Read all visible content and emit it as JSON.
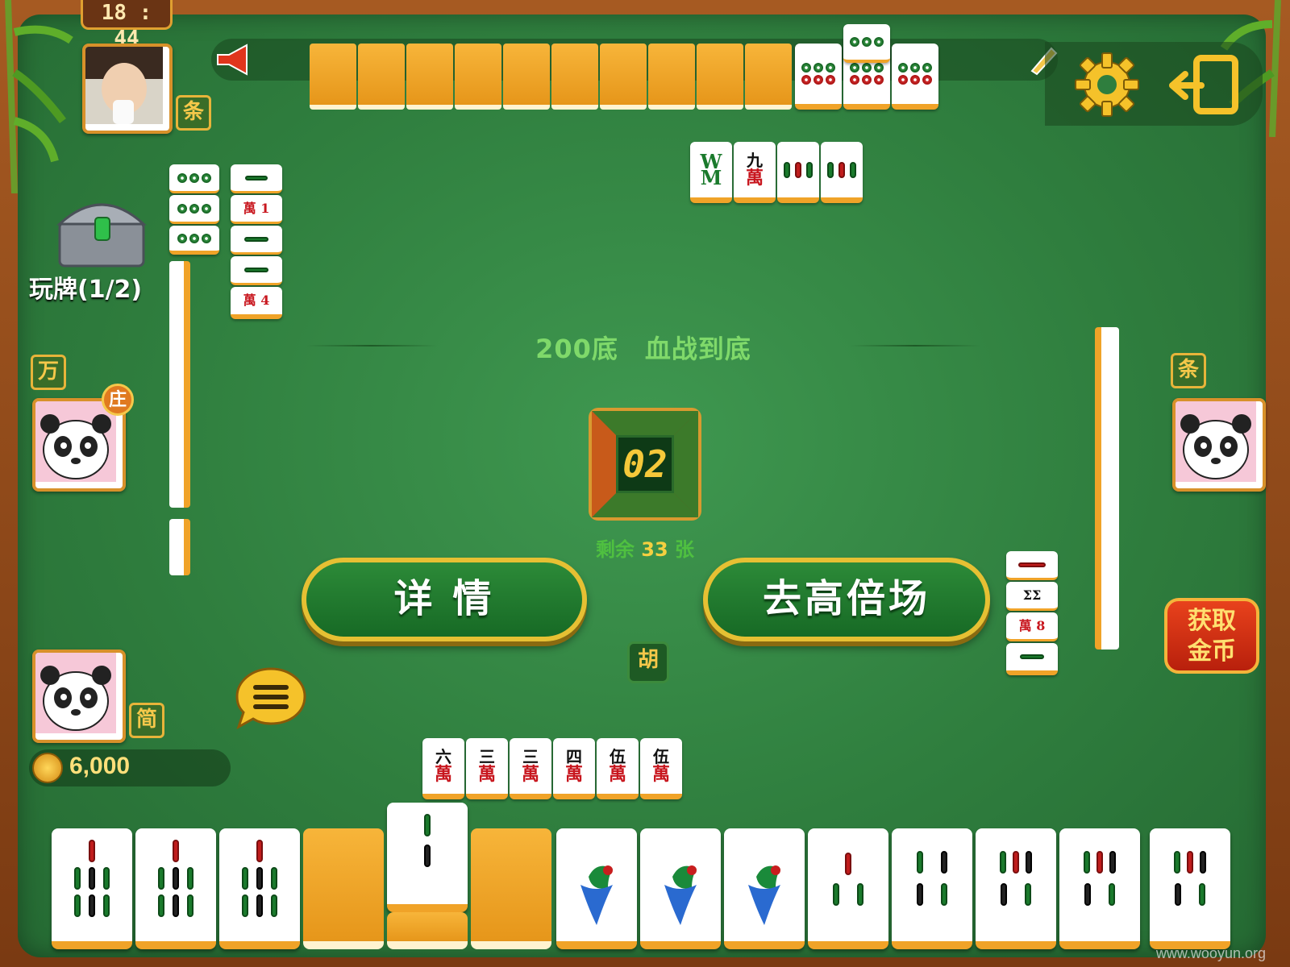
{
  "status_bar": {
    "clock": "18 : 44"
  },
  "players": {
    "top": {
      "suit_badge": "条"
    },
    "left": {
      "suit_badge": "万",
      "dealer_badge": "庄"
    },
    "right": {
      "suit_badge": "条"
    },
    "self": {
      "suit_badge": "简",
      "coins": "6,000"
    }
  },
  "treasure": {
    "label": "玩牌(1/2)"
  },
  "table": {
    "info": "200底　血战到底",
    "timer": "02",
    "remaining": {
      "prefix": "剩余 ",
      "count": "33",
      "suffix": " 张"
    }
  },
  "buttons": {
    "details": "详 情",
    "high_stakes": "去高倍场",
    "get_gold_line1": "获取",
    "get_gold_line2": "金币",
    "hu": "胡"
  },
  "top_discards": [
    {
      "top": "",
      "bottom": "W",
      "type": "wind"
    },
    {
      "top": "九",
      "bottom": "萬",
      "type": "wan"
    },
    {
      "top": "",
      "bottom": "",
      "type": "bamboo"
    },
    {
      "top": "",
      "bottom": "",
      "type": "bamboo"
    }
  ],
  "self_discards": [
    {
      "top": "六",
      "bottom": "萬"
    },
    {
      "top": "三",
      "bottom": "萬"
    },
    {
      "top": "三",
      "bottom": "萬"
    },
    {
      "top": "四",
      "bottom": "萬"
    },
    {
      "top": "伍",
      "bottom": "萬"
    },
    {
      "top": "伍",
      "bottom": "萬"
    }
  ],
  "icons": {
    "speaker": "speaker-icon",
    "pencil": "pencil-icon",
    "settings": "gear-icon",
    "exit": "exit-icon",
    "chat": "chat-bubble-icon"
  },
  "watermark": "www.wooyun.org"
}
